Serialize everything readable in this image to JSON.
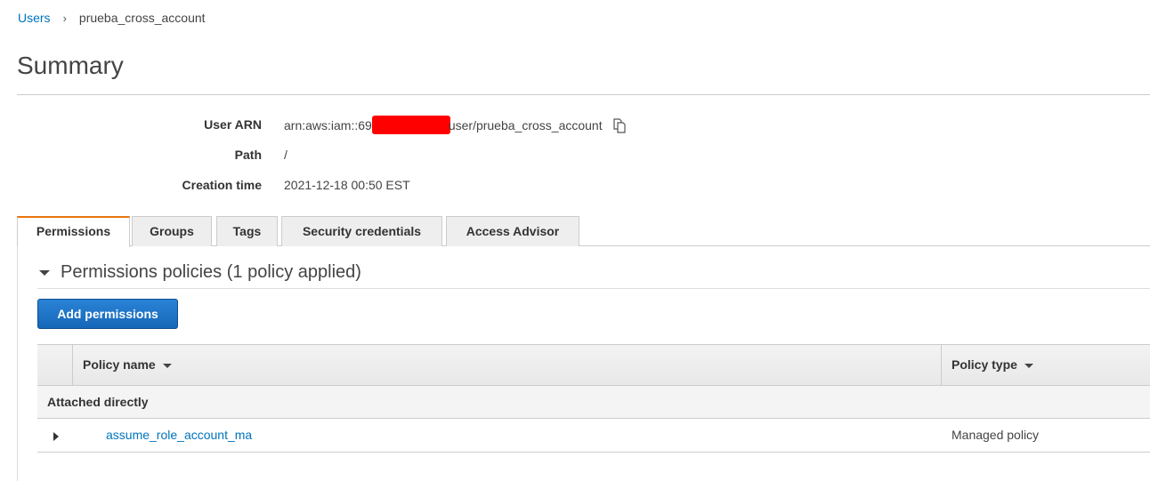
{
  "breadcrumb": {
    "parent": "Users",
    "separator": "›",
    "current": "prueba_cross_account"
  },
  "page": {
    "title": "Summary"
  },
  "summary": {
    "user_arn_label": "User ARN",
    "user_arn_prefix": "arn:aws:iam::69",
    "user_arn_suffix": "user/prueba_cross_account",
    "path_label": "Path",
    "path_value": "/",
    "creation_time_label": "Creation time",
    "creation_time_value": "2021-12-18 00:50 EST"
  },
  "tabs": [
    {
      "label": "Permissions",
      "active": true
    },
    {
      "label": "Groups",
      "active": false
    },
    {
      "label": "Tags",
      "active": false
    },
    {
      "label": "Security credentials",
      "active": false
    },
    {
      "label": "Access Advisor",
      "active": false
    }
  ],
  "permissions": {
    "section_title": "Permissions policies (1 policy applied)",
    "add_button": "Add permissions",
    "table": {
      "columns": [
        "Policy name",
        "Policy type"
      ],
      "groups": [
        {
          "label": "Attached directly",
          "rows": [
            {
              "policy_name": "assume_role_account_ma",
              "policy_type": "Managed policy"
            }
          ]
        }
      ]
    }
  },
  "colors": {
    "link": "#0073bb",
    "active_tab_accent": "#e7750c",
    "primary_button": "#1f75c9",
    "redaction": "#ff0000"
  }
}
